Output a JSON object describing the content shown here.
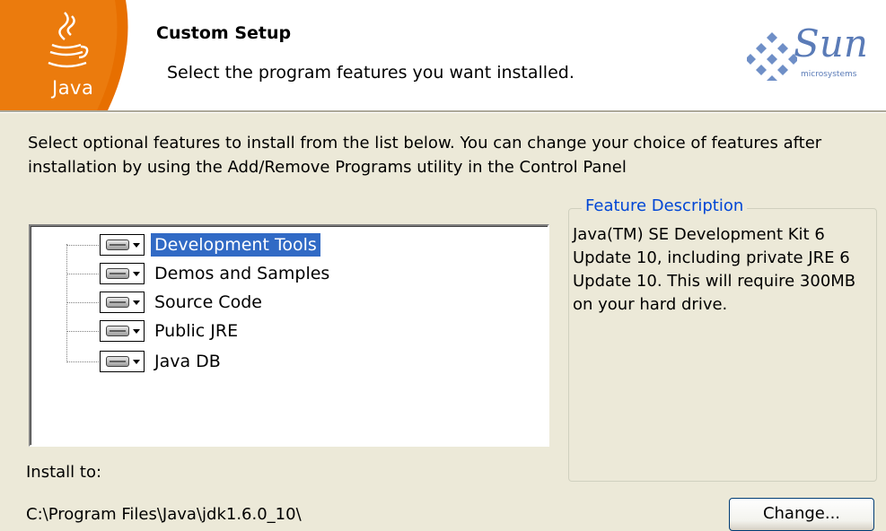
{
  "header": {
    "logo_text": "Java",
    "title": "Custom Setup",
    "subtitle": "Select the program features you want installed.",
    "brand_word": "Sun",
    "brand_sub": "microsystems"
  },
  "instructions": "Select optional features to install from the list below.  You can change your choice of features after installation by using the Add/Remove Programs utility in the Control Panel",
  "features": [
    {
      "label": "Development Tools",
      "selected": true
    },
    {
      "label": "Demos and Samples",
      "selected": false
    },
    {
      "label": "Source Code",
      "selected": false
    },
    {
      "label": "Public JRE",
      "selected": false
    },
    {
      "label": "Java DB",
      "selected": false
    }
  ],
  "description": {
    "legend": "Feature Description",
    "text": "Java(TM) SE Development Kit 6 Update 10, including private JRE 6 Update 10.  This will require 300MB on your hard drive."
  },
  "install": {
    "label": "Install to:",
    "path": "C:\\Program Files\\Java\\jdk1.6.0_10\\"
  },
  "buttons": {
    "change": "Change..."
  },
  "colors": {
    "accent": "#316ac5",
    "java_orange": "#e76f00",
    "sun_blue": "#5a7bb7",
    "legend_blue": "#0046d5"
  }
}
